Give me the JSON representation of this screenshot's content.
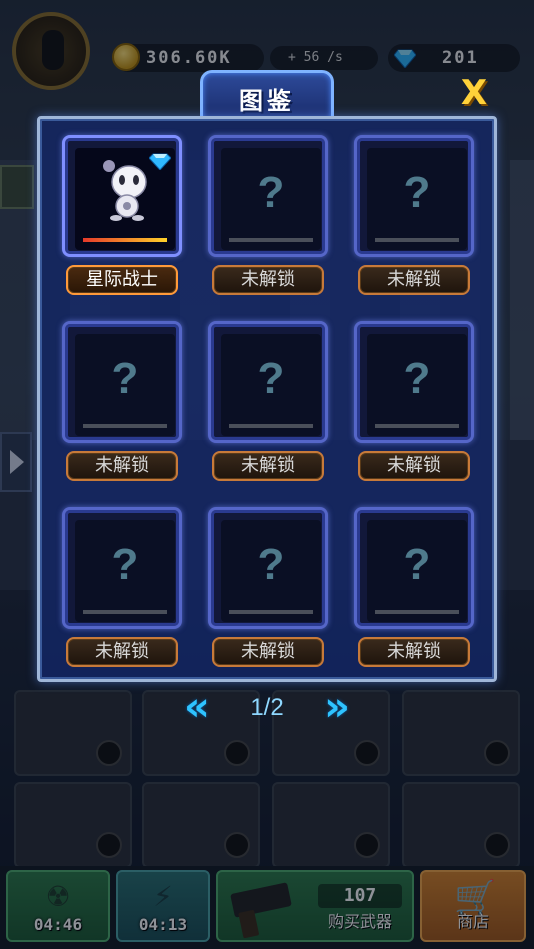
{
  "hud": {
    "coins": "306.60K",
    "coin_rate": "+ 56 /s",
    "gems": "201"
  },
  "album": {
    "title": "图鉴",
    "close_label": "X",
    "cards": [
      {
        "name": "星际战士",
        "unlocked": true
      },
      {
        "name": "未解锁",
        "unlocked": false
      },
      {
        "name": "未解锁",
        "unlocked": false
      },
      {
        "name": "未解锁",
        "unlocked": false
      },
      {
        "name": "未解锁",
        "unlocked": false
      },
      {
        "name": "未解锁",
        "unlocked": false
      },
      {
        "name": "未解锁",
        "unlocked": false
      },
      {
        "name": "未解锁",
        "unlocked": false
      },
      {
        "name": "未解锁",
        "unlocked": false
      }
    ],
    "locked_mark": "?",
    "pager": {
      "prev": "«",
      "page": "1/2",
      "next": "»"
    }
  },
  "bottom_bar": {
    "timer_1": "04:46",
    "timer_2": "04:13",
    "weapon_price": "107",
    "buy_weapon_label": "购买武器",
    "shop_label": "商店"
  },
  "colors": {
    "accent_blue": "#2ec3ff",
    "close_yellow": "#ffd23a",
    "plate_orange": "#c77a3a",
    "gem_blue": "#2fb8ff"
  },
  "icons": {
    "coin": "coin-icon",
    "gem": "diamond-icon",
    "close": "close-icon",
    "shop": "cart-icon",
    "boost": "lightning-icon",
    "spin": "radiation-icon"
  }
}
